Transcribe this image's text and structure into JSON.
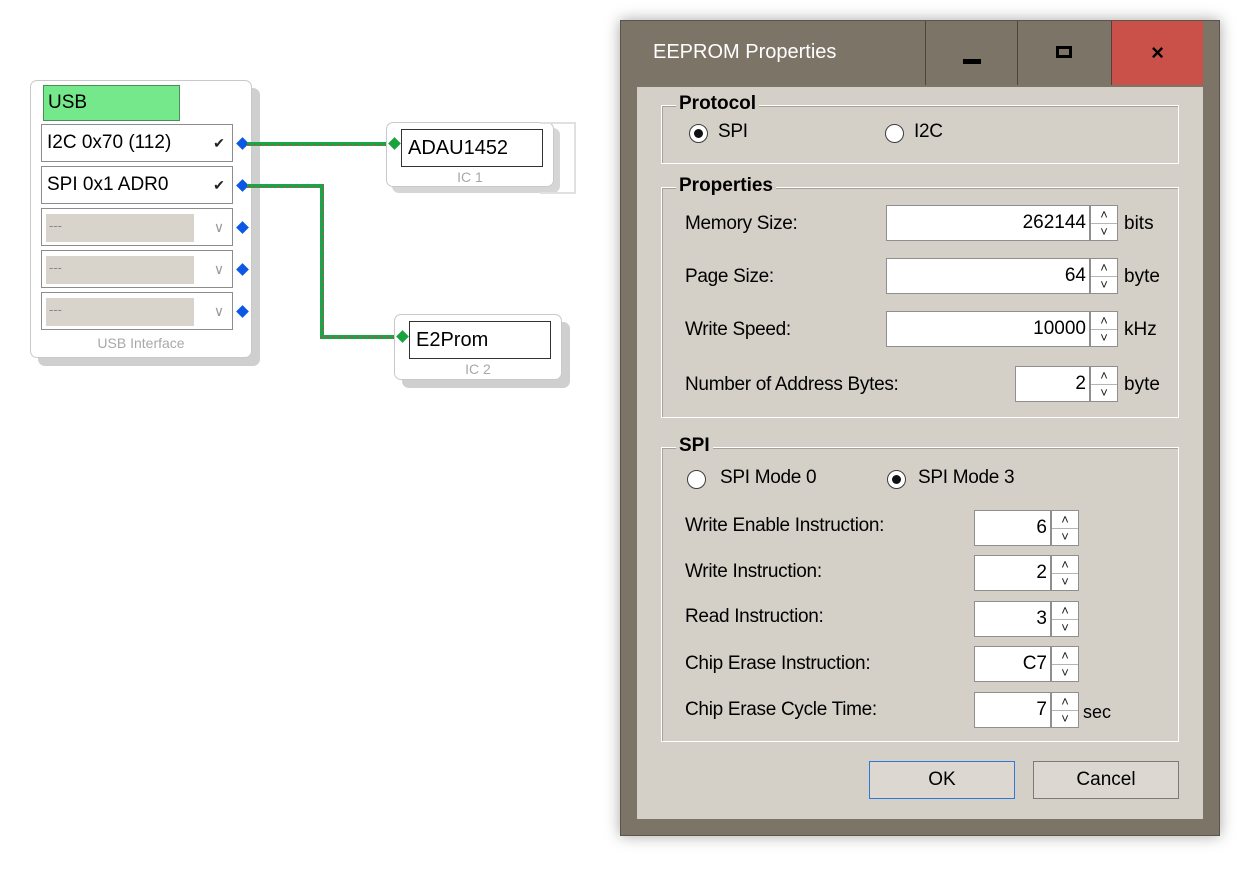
{
  "canvas": {
    "usb_block": {
      "title": "USB",
      "ports": [
        {
          "label": "I2C 0x70 (112)",
          "enabled": true
        },
        {
          "label": "SPI 0x1 ADR0",
          "enabled": true
        },
        {
          "label": "---",
          "enabled": false
        },
        {
          "label": "---",
          "enabled": false
        },
        {
          "label": "---",
          "enabled": false
        }
      ],
      "caption": "USB Interface"
    },
    "ic1": {
      "name": "ADAU1452",
      "caption": "IC 1"
    },
    "ic2": {
      "name": "E2Prom",
      "caption": "IC 2"
    },
    "colors": {
      "usb_title_bg": "#74e88a",
      "port_dot": "#0b57e6",
      "wire": "#19a64a",
      "wire_dash": "#d04040"
    }
  },
  "dialog": {
    "title": "EEPROM Properties",
    "controls": {
      "minimize": "minimize-icon",
      "maximize": "maximize-icon",
      "close": "×"
    },
    "protocol": {
      "group_title": "Protocol",
      "options": [
        "SPI",
        "I2C"
      ],
      "selected": "SPI"
    },
    "properties": {
      "group_title": "Properties",
      "memory_size": {
        "label": "Memory Size:",
        "value": "262144",
        "unit": "bits"
      },
      "page_size": {
        "label": "Page Size:",
        "value": "64",
        "unit": "byte"
      },
      "write_speed": {
        "label": "Write Speed:",
        "value": "10000",
        "unit": "kHz"
      },
      "address_bytes": {
        "label": "Number of Address Bytes:",
        "value": "2",
        "unit": "byte"
      }
    },
    "spi": {
      "group_title": "SPI",
      "modes": [
        "SPI Mode 0",
        "SPI Mode 3"
      ],
      "selected_mode": "SPI Mode 3",
      "write_enable": {
        "label": "Write Enable Instruction:",
        "value": "6"
      },
      "write_instr": {
        "label": "Write Instruction:",
        "value": "2"
      },
      "read_instr": {
        "label": "Read Instruction:",
        "value": "3"
      },
      "chip_erase": {
        "label": "Chip Erase Instruction:",
        "value": "C7"
      },
      "chip_erase_time": {
        "label": "Chip Erase Cycle Time:",
        "value": "7",
        "unit": "sec"
      }
    },
    "buttons": {
      "ok": "OK",
      "cancel": "Cancel"
    },
    "colors": {
      "frame": "#7d7468",
      "client": "#d5d0c7",
      "close_bg": "#c9514a"
    }
  }
}
